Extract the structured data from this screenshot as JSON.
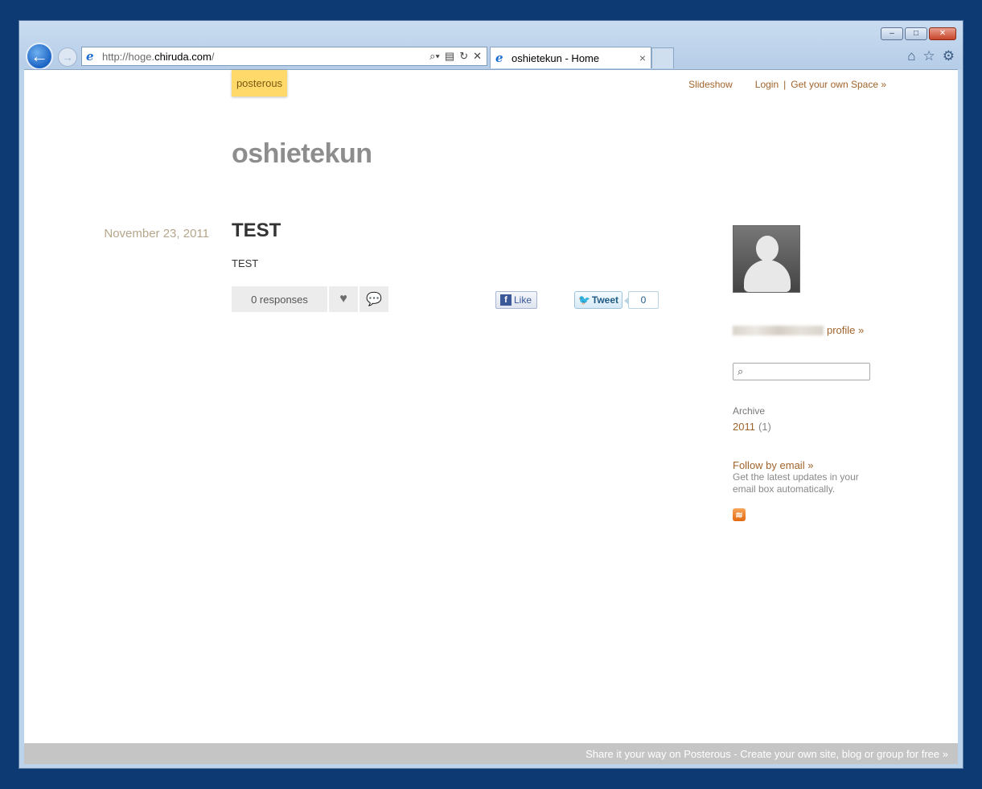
{
  "browser": {
    "url_prefix": "http://hoge.",
    "url_domain": "chiruda.com",
    "url_suffix": "/",
    "tab_title": "oshietekun - Home",
    "win_minimize": "–",
    "win_restore": "□",
    "win_close": "✕"
  },
  "site": {
    "brand": "posterous",
    "title": "oshietekun",
    "nav": {
      "slideshow": "Slideshow",
      "login": "Login",
      "get_space": "Get your own Space »"
    }
  },
  "post": {
    "date": "November 23, 2011",
    "title": "TEST",
    "body": "TEST",
    "responses": "0 responses",
    "like_label": "Like",
    "tweet_label": "Tweet",
    "tweet_count": "0"
  },
  "sidebar": {
    "profile_link": "profile »",
    "archive_label": "Archive",
    "archive_year": "2011",
    "archive_count": "(1)",
    "follow_link": "Follow by email »",
    "follow_desc": "Get the latest updates in your email box automatically."
  },
  "footer": {
    "text": "Share it your way on Posterous - Create your own site, blog or group for free »"
  },
  "icons": [
    "back-arrow-icon",
    "forward-arrow-icon",
    "ie-icon",
    "search-icon",
    "refresh-icon",
    "stop-icon",
    "home-icon",
    "favorites-star-icon",
    "gear-icon",
    "heart-icon",
    "comment-icon",
    "facebook-icon",
    "twitter-bird-icon",
    "rss-icon",
    "avatar-placeholder-icon"
  ],
  "colors": {
    "desktop": "#0d3a73",
    "brand_tab": "#ffd96a",
    "link": "#a0642b",
    "title_gray": "#8d8d8d",
    "footer_bar": "#c5c5c5"
  }
}
